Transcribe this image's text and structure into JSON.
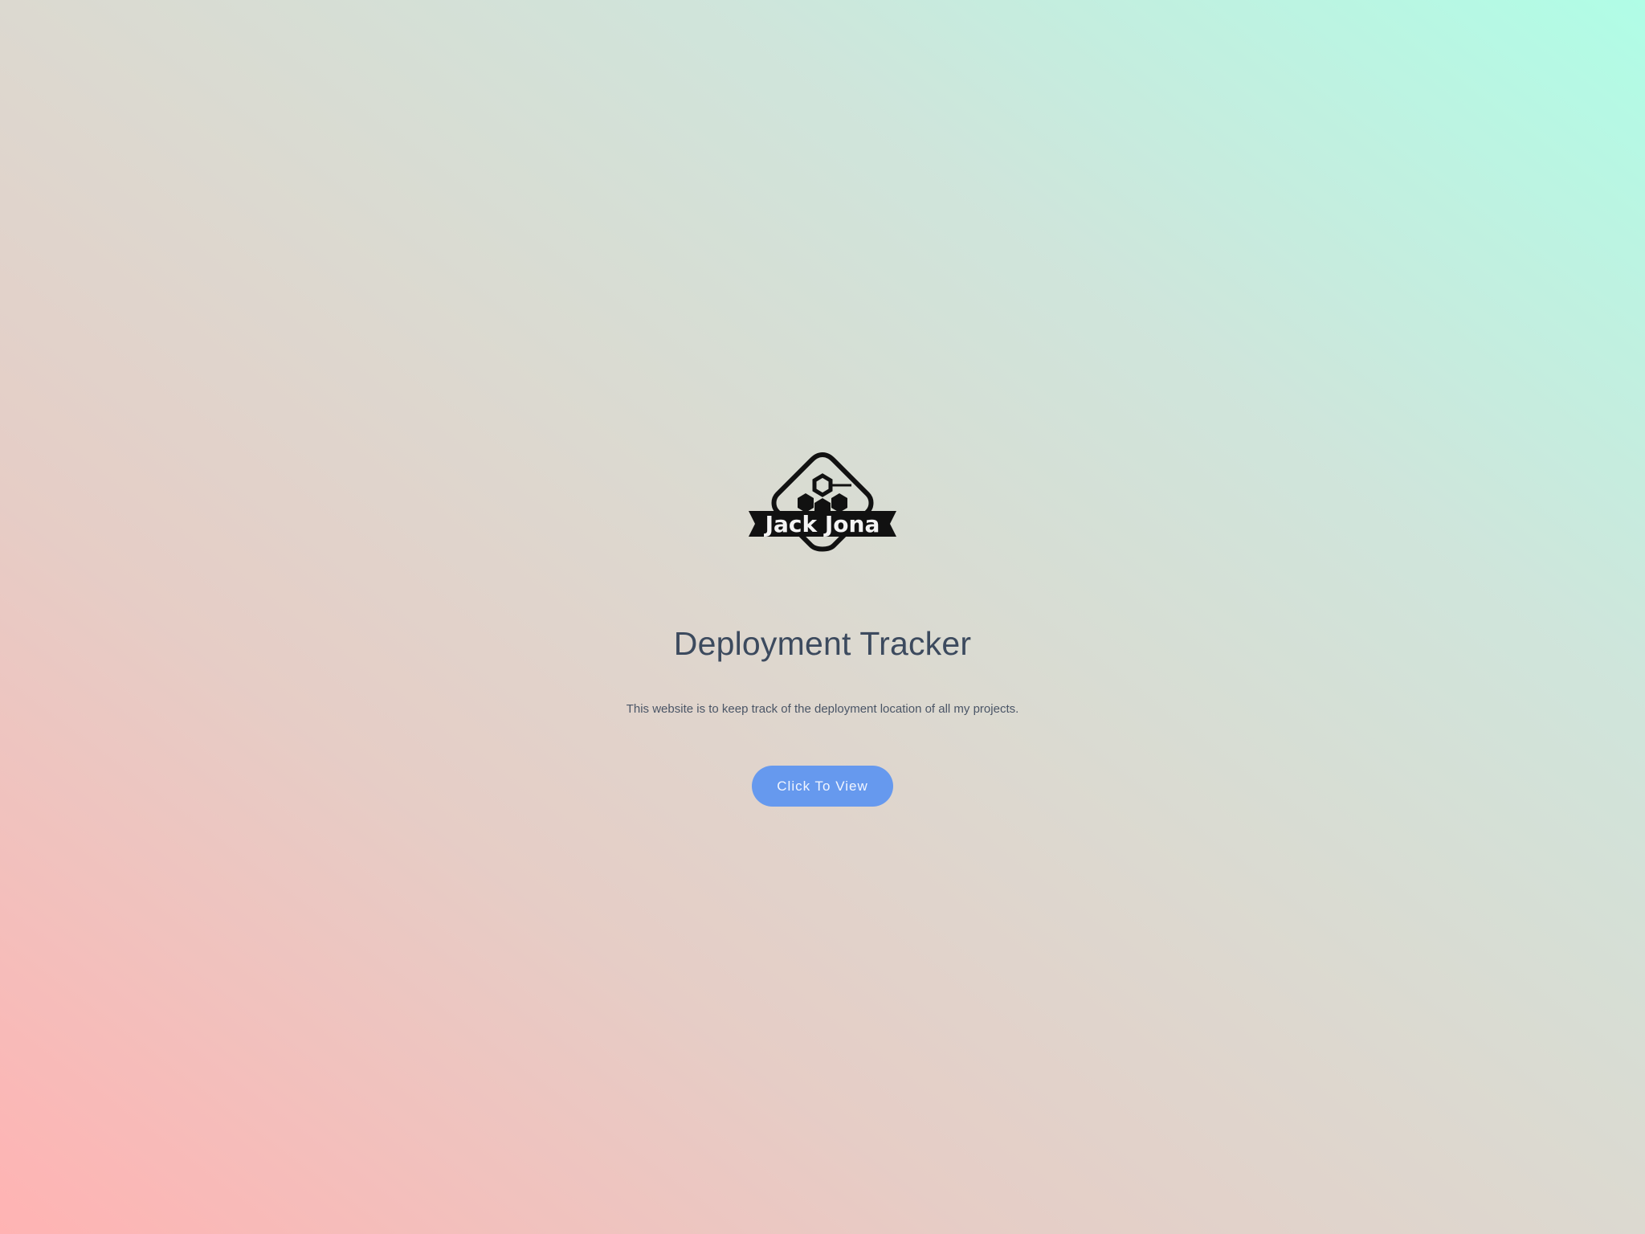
{
  "logo": {
    "icon": "hexagon-badge-logo",
    "text": "Jack Jona"
  },
  "main": {
    "title": "Deployment Tracker",
    "description": "This website is to keep track of the deployment location of all my projects.",
    "cta_label": "Click To View"
  },
  "colors": {
    "button": "#6699ee",
    "title_text": "#3c4a5e",
    "gradient_start": "#ffb3b3",
    "gradient_end": "#b0fde6"
  }
}
